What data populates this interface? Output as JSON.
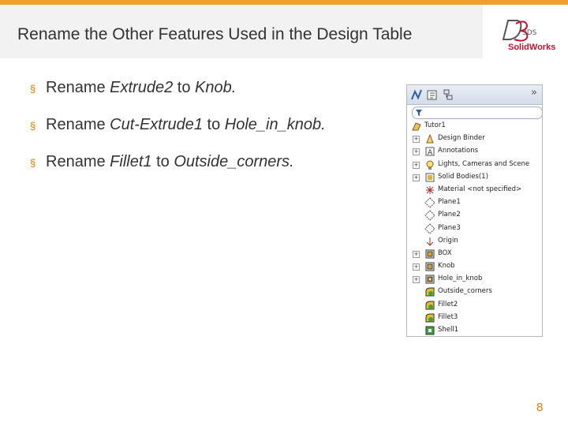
{
  "slide": {
    "title": "Rename the Other Features Used in the Design Table",
    "page_number": "8",
    "logo_text": "SolidWorks",
    "logo_mark": "3DS"
  },
  "bullets": [
    {
      "prefix": "Rename ",
      "old": "Extrude2",
      "mid": " to ",
      "new": "Knob",
      "end": "."
    },
    {
      "prefix": "Rename ",
      "old": "Cut-Extrude1",
      "mid": " to ",
      "new": "Hole_in_knob",
      "end": "."
    },
    {
      "prefix": "Rename ",
      "old": "Fillet1",
      "mid": " to ",
      "new": "Outside_corners",
      "end": "."
    }
  ],
  "feature_tree": {
    "root": "Tutor1",
    "items": [
      {
        "label": "Design Binder",
        "icon": "binder-icon",
        "expandable": true
      },
      {
        "label": "Annotations",
        "icon": "annotations-icon",
        "expandable": true
      },
      {
        "label": "Lights, Cameras and Scene",
        "icon": "lights-icon",
        "expandable": true
      },
      {
        "label": "Solid Bodies(1)",
        "icon": "solid-bodies-icon",
        "expandable": true
      },
      {
        "label": "Material <not specified>",
        "icon": "material-icon",
        "expandable": false
      },
      {
        "label": "Plane1",
        "icon": "plane-icon",
        "expandable": false
      },
      {
        "label": "Plane2",
        "icon": "plane-icon",
        "expandable": false
      },
      {
        "label": "Plane3",
        "icon": "plane-icon",
        "expandable": false
      },
      {
        "label": "Origin",
        "icon": "origin-icon",
        "expandable": false
      },
      {
        "label": "BOX",
        "icon": "extrude-icon",
        "expandable": true
      },
      {
        "label": "Knob",
        "icon": "extrude-icon",
        "expandable": true
      },
      {
        "label": "Hole_in_knob",
        "icon": "cut-extrude-icon",
        "expandable": true
      },
      {
        "label": "Outside_corners",
        "icon": "fillet-icon",
        "expandable": false
      },
      {
        "label": "Fillet2",
        "icon": "fillet-icon",
        "expandable": false
      },
      {
        "label": "Fillet3",
        "icon": "fillet-icon",
        "expandable": false
      },
      {
        "label": "Shell1",
        "icon": "shell-icon",
        "expandable": false
      }
    ]
  },
  "colors": {
    "accent": "#f0a030",
    "bullet": "#e07b00",
    "brand": "#c8102e"
  }
}
